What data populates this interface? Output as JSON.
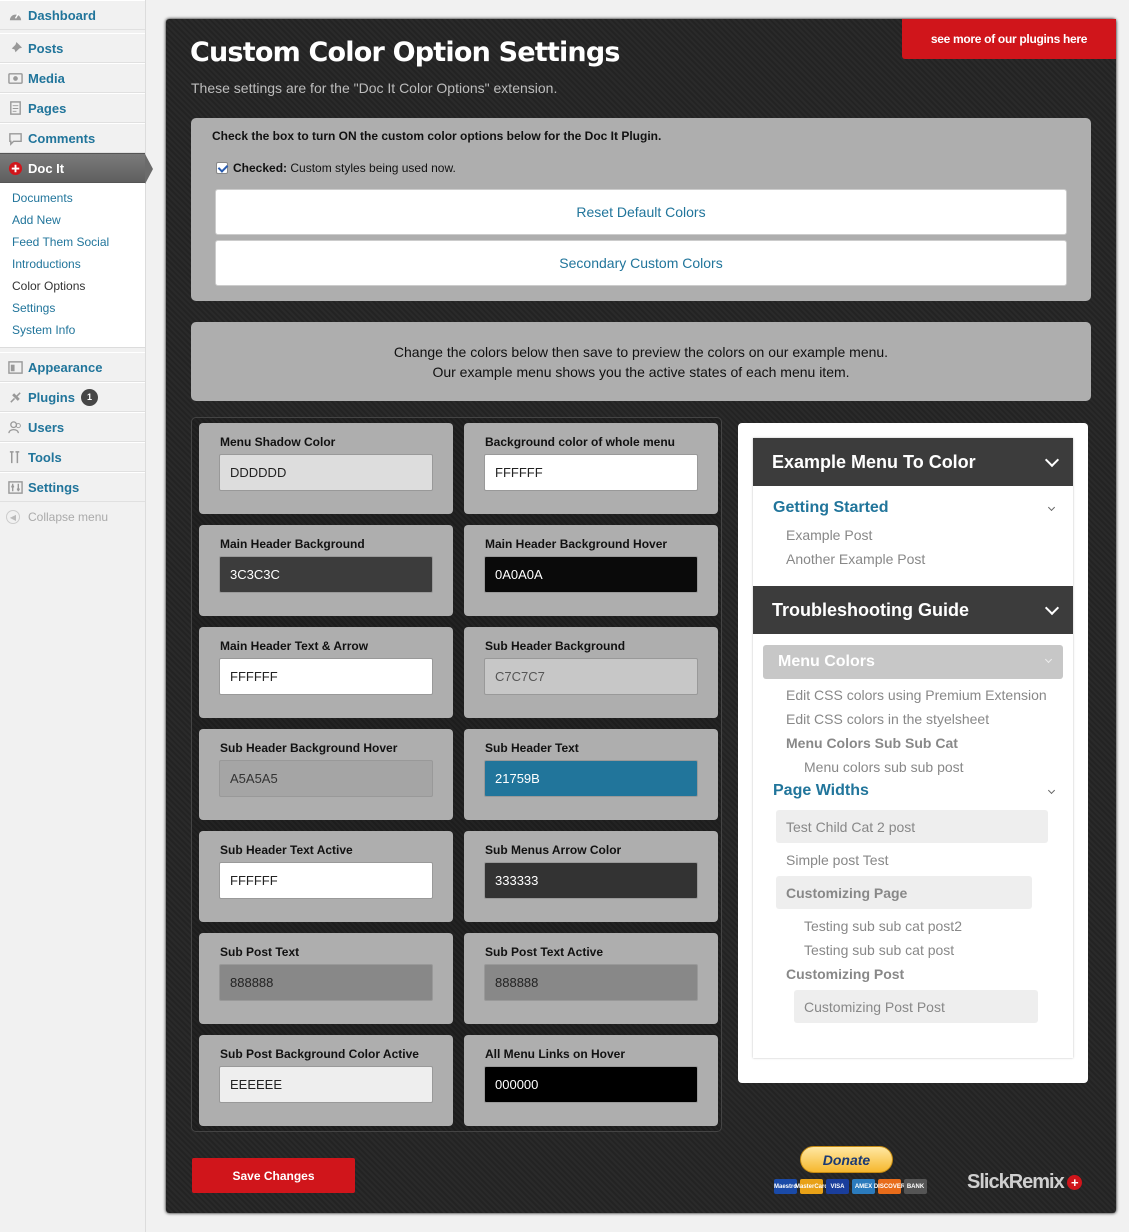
{
  "sidebar": {
    "items": [
      {
        "label": "Dashboard",
        "icon": "dashboard-icon"
      },
      {
        "label": "Posts",
        "icon": "pin-icon"
      },
      {
        "label": "Media",
        "icon": "media-icon"
      },
      {
        "label": "Pages",
        "icon": "pages-icon"
      },
      {
        "label": "Comments",
        "icon": "comment-icon"
      },
      {
        "label": "Doc It",
        "icon": "doc-it-plus-icon"
      },
      {
        "label": "Appearance",
        "icon": "appearance-icon"
      },
      {
        "label": "Plugins",
        "icon": "plugin-icon",
        "badge": "1"
      },
      {
        "label": "Users",
        "icon": "users-icon"
      },
      {
        "label": "Tools",
        "icon": "tools-icon"
      },
      {
        "label": "Settings",
        "icon": "settings-icon"
      }
    ],
    "docit_submenu": [
      "Documents",
      "Add New",
      "Feed Them Social",
      "Introductions",
      "Color Options",
      "Settings",
      "System Info"
    ],
    "collapse_label": "Collapse menu"
  },
  "header": {
    "title": "Custom Color Option Settings",
    "subtitle": "These settings are for the \"Doc It Color Options\" extension.",
    "plugins_link": "see more of our plugins here"
  },
  "toggle": {
    "instruction": "Check the box to turn ON the custom color options below for the Doc It Plugin.",
    "checked_label": "Checked:",
    "checked_text": "Custom styles being used now.",
    "reset_button": "Reset Default Colors",
    "secondary_button": "Secondary Custom Colors"
  },
  "intro": {
    "line1": "Change the colors below then save to preview the colors on our example menu.",
    "line2": "Our example menu shows you the active states of each menu item."
  },
  "fields": [
    {
      "label": "Menu Shadow Color",
      "value": "DDDDDD",
      "bg": "#DDDDDD",
      "fg": "#222222"
    },
    {
      "label": "Background color of whole menu",
      "value": "FFFFFF",
      "bg": "#FFFFFF",
      "fg": "#222222"
    },
    {
      "label": "Main Header Background",
      "value": "3C3C3C",
      "bg": "#3C3C3C",
      "fg": "#FFFFFF"
    },
    {
      "label": "Main Header Background Hover",
      "value": "0A0A0A",
      "bg": "#0A0A0A",
      "fg": "#FFFFFF"
    },
    {
      "label": "Main Header Text & Arrow",
      "value": "FFFFFF",
      "bg": "#FFFFFF",
      "fg": "#222222"
    },
    {
      "label": "Sub Header Background",
      "value": "C7C7C7",
      "bg": "#C7C7C7",
      "fg": "#555555"
    },
    {
      "label": "Sub Header Background Hover",
      "value": "A5A5A5",
      "bg": "#A5A5A5",
      "fg": "#333333"
    },
    {
      "label": "Sub Header Text",
      "value": "21759B",
      "bg": "#21759B",
      "fg": "#FFFFFF"
    },
    {
      "label": "Sub Header Text Active",
      "value": "FFFFFF",
      "bg": "#FFFFFF",
      "fg": "#222222"
    },
    {
      "label": "Sub Menus Arrow Color",
      "value": "333333",
      "bg": "#333333",
      "fg": "#FFFFFF"
    },
    {
      "label": "Sub Post Text",
      "value": "888888",
      "bg": "#888888",
      "fg": "#222222"
    },
    {
      "label": "Sub Post Text Active",
      "value": "888888",
      "bg": "#888888",
      "fg": "#222222"
    },
    {
      "label": "Sub Post Background Color Active",
      "value": "EEEEEE",
      "bg": "#EEEEEE",
      "fg": "#222222"
    },
    {
      "label": "All Menu Links on Hover",
      "value": "000000",
      "bg": "#000000",
      "fg": "#FFFFFF"
    }
  ],
  "example_menu": {
    "header1": "Example Menu To Color",
    "getting_started": "Getting Started",
    "example_post": "Example Post",
    "another_example_post": "Another Example Post",
    "header2": "Troubleshooting Guide",
    "menu_colors": "Menu Colors",
    "edit_css_premium": "Edit CSS colors using Premium Extension",
    "edit_css_stylesheet": "Edit CSS colors in the styelsheet",
    "menu_colors_sub_sub_cat": "Menu Colors Sub Sub Cat",
    "menu_colors_sub_sub_post": "Menu colors sub sub post",
    "page_widths": "Page Widths",
    "test_child_cat": "Test Child Cat 2 post",
    "simple_post_test": "Simple post Test",
    "customizing_page": "Customizing Page",
    "testing_sub_sub_cat_post2": "Testing sub sub cat post2",
    "testing_sub_sub_cat_post": "Testing sub sub cat post",
    "customizing_post": "Customizing Post",
    "customizing_post_post": "Customizing Post Post"
  },
  "footer": {
    "save_button": "Save Changes",
    "donate_button": "Donate",
    "cards": [
      "Maestro",
      "MasterCard",
      "VISA",
      "AMEX",
      "DISCOVER",
      "BANK"
    ],
    "brand": "SlickRemix"
  },
  "colors": {
    "accent_red": "#d0151b",
    "link_blue": "#21759b",
    "panel_dark": "#262626",
    "box_grey": "#aeaeae"
  }
}
